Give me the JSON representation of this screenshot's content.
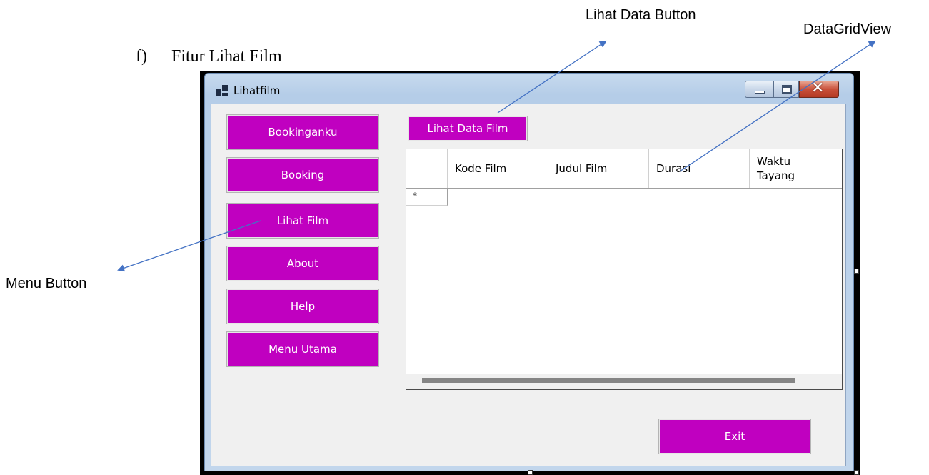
{
  "document": {
    "heading_number": "f)",
    "heading_text": "Fitur Lihat Film"
  },
  "callouts": {
    "lihat_data_button": "Lihat Data Button",
    "datagridview": "DataGridView",
    "menu_button": "Menu Button"
  },
  "window": {
    "title": "Lihatfilm",
    "controls": {
      "minimize": "minimize",
      "maximize": "maximize",
      "close": "close"
    }
  },
  "menu": {
    "items": [
      {
        "label": "Bookinganku"
      },
      {
        "label": "Booking"
      },
      {
        "label": "Lihat Film"
      },
      {
        "label": "About"
      },
      {
        "label": "Help"
      },
      {
        "label": "Menu Utama"
      }
    ]
  },
  "toolbar": {
    "lihat_data_label": "Lihat Data Film"
  },
  "grid": {
    "columns": [
      "Kode Film",
      "Judul Film",
      "Durasi",
      "Waktu\nTayang"
    ],
    "new_row_marker": "*"
  },
  "footer": {
    "exit_label": "Exit"
  },
  "colors": {
    "button": "#c000c0",
    "button_text": "#ffffff",
    "client_background": "#f0f0f0",
    "arrow": "#4472c4",
    "close_button": "#c9503a"
  },
  "icons": {
    "app": "window-app-icon",
    "minimize": "minimize-icon",
    "maximize": "maximize-icon",
    "close": "close-icon"
  }
}
